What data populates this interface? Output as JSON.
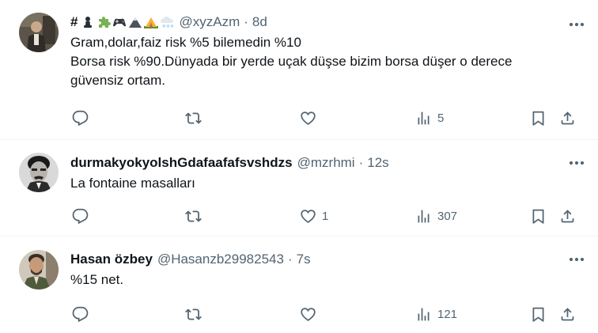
{
  "tweets": [
    {
      "name": "#",
      "name_emojis": [
        "chess-pawn-emoji",
        "puzzle-piece-emoji",
        "game-controller-emoji",
        "mountain-emoji",
        "tent-emoji",
        "cloud-snow-emoji"
      ],
      "handle": "@xyzAzm",
      "time": "8d",
      "lines": [
        "Gram,dolar,faiz risk %5 bilemedin %10",
        "Borsa risk %90.Dünyada bir yerde uçak düşse bizim borsa düşer o derece",
        "güvensiz ortam."
      ],
      "counts": {
        "reply": "",
        "retweet": "",
        "like": "",
        "views": "5"
      }
    },
    {
      "name": "durmakyokyolshGdafaafafsvshdzs",
      "handle": "@mzrhmi",
      "time": "12s",
      "lines": [
        "La fontaine masalları"
      ],
      "counts": {
        "reply": "",
        "retweet": "",
        "like": "1",
        "views": "307"
      }
    },
    {
      "name": "Hasan özbey",
      "handle": "@Hasanzb29982543",
      "time": "7s",
      "lines": [
        "%15 net."
      ],
      "counts": {
        "reply": "",
        "retweet": "",
        "like": "",
        "views": "121"
      }
    }
  ],
  "dot": "·",
  "colors": {
    "text": "#0f1419",
    "muted": "#536471",
    "divider": "#eff3f4"
  },
  "icons": [
    "reply-icon",
    "retweet-icon",
    "like-icon",
    "views-icon",
    "bookmark-icon",
    "share-icon",
    "more-icon"
  ]
}
